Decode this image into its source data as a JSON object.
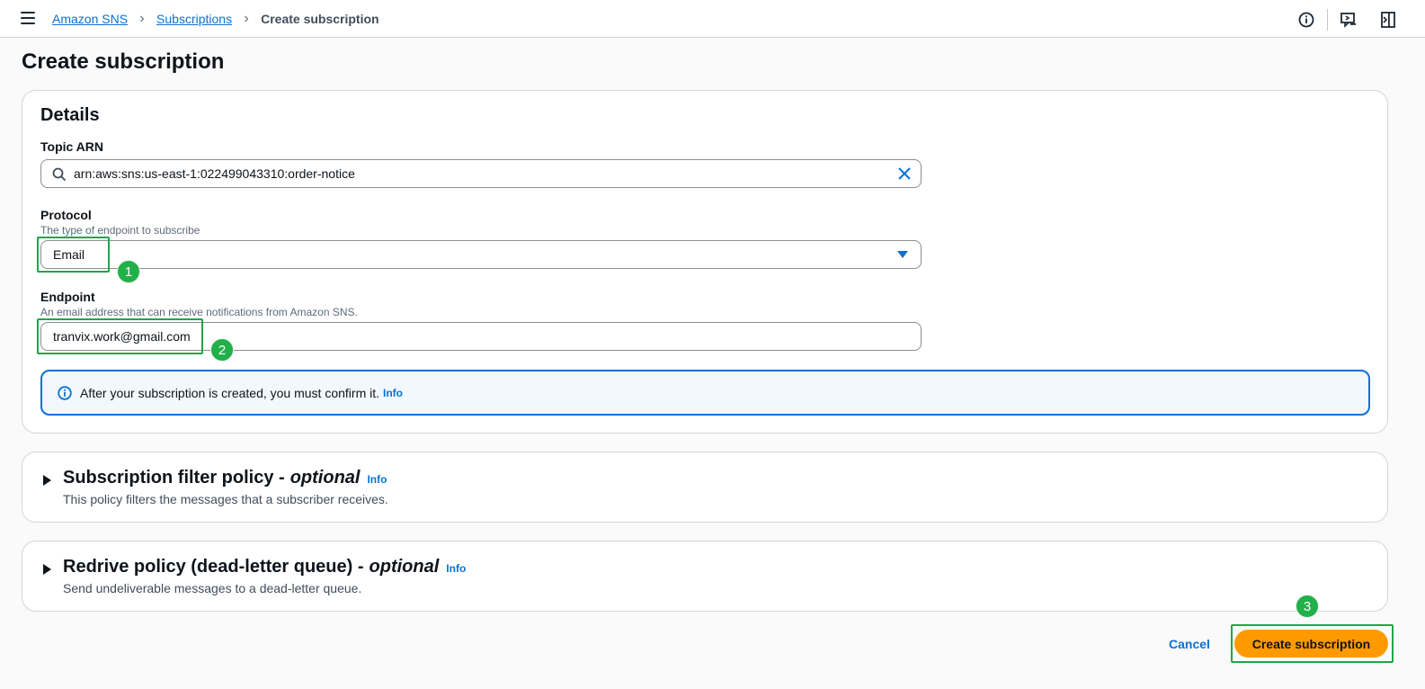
{
  "breadcrumb": {
    "root": "Amazon SNS",
    "parent": "Subscriptions",
    "current": "Create subscription"
  },
  "page_title": "Create subscription",
  "details": {
    "heading": "Details",
    "topic_arn": {
      "label": "Topic ARN",
      "value": "arn:aws:sns:us-east-1:022499043310:order-notice"
    },
    "protocol": {
      "label": "Protocol",
      "description": "The type of endpoint to subscribe",
      "value": "Email"
    },
    "endpoint": {
      "label": "Endpoint",
      "description": "An email address that can receive notifications from Amazon SNS.",
      "value": "tranvix.work@gmail.com"
    },
    "alert": {
      "text": "After your subscription is created, you must confirm it.",
      "info": "Info"
    }
  },
  "filter_policy": {
    "title": "Subscription filter policy -",
    "optional": "optional",
    "info": "Info",
    "description": "This policy filters the messages that a subscriber receives."
  },
  "redrive_policy": {
    "title": "Redrive policy (dead-letter queue) -",
    "optional": "optional",
    "info": "Info",
    "description": "Send undeliverable messages to a dead-letter queue."
  },
  "actions": {
    "cancel": "Cancel",
    "create": "Create subscription"
  },
  "annotations": [
    "1",
    "2",
    "3"
  ],
  "colors": {
    "link": "#0972d3",
    "primary_button": "#ff9900",
    "annotation_green": "#22b04a"
  }
}
